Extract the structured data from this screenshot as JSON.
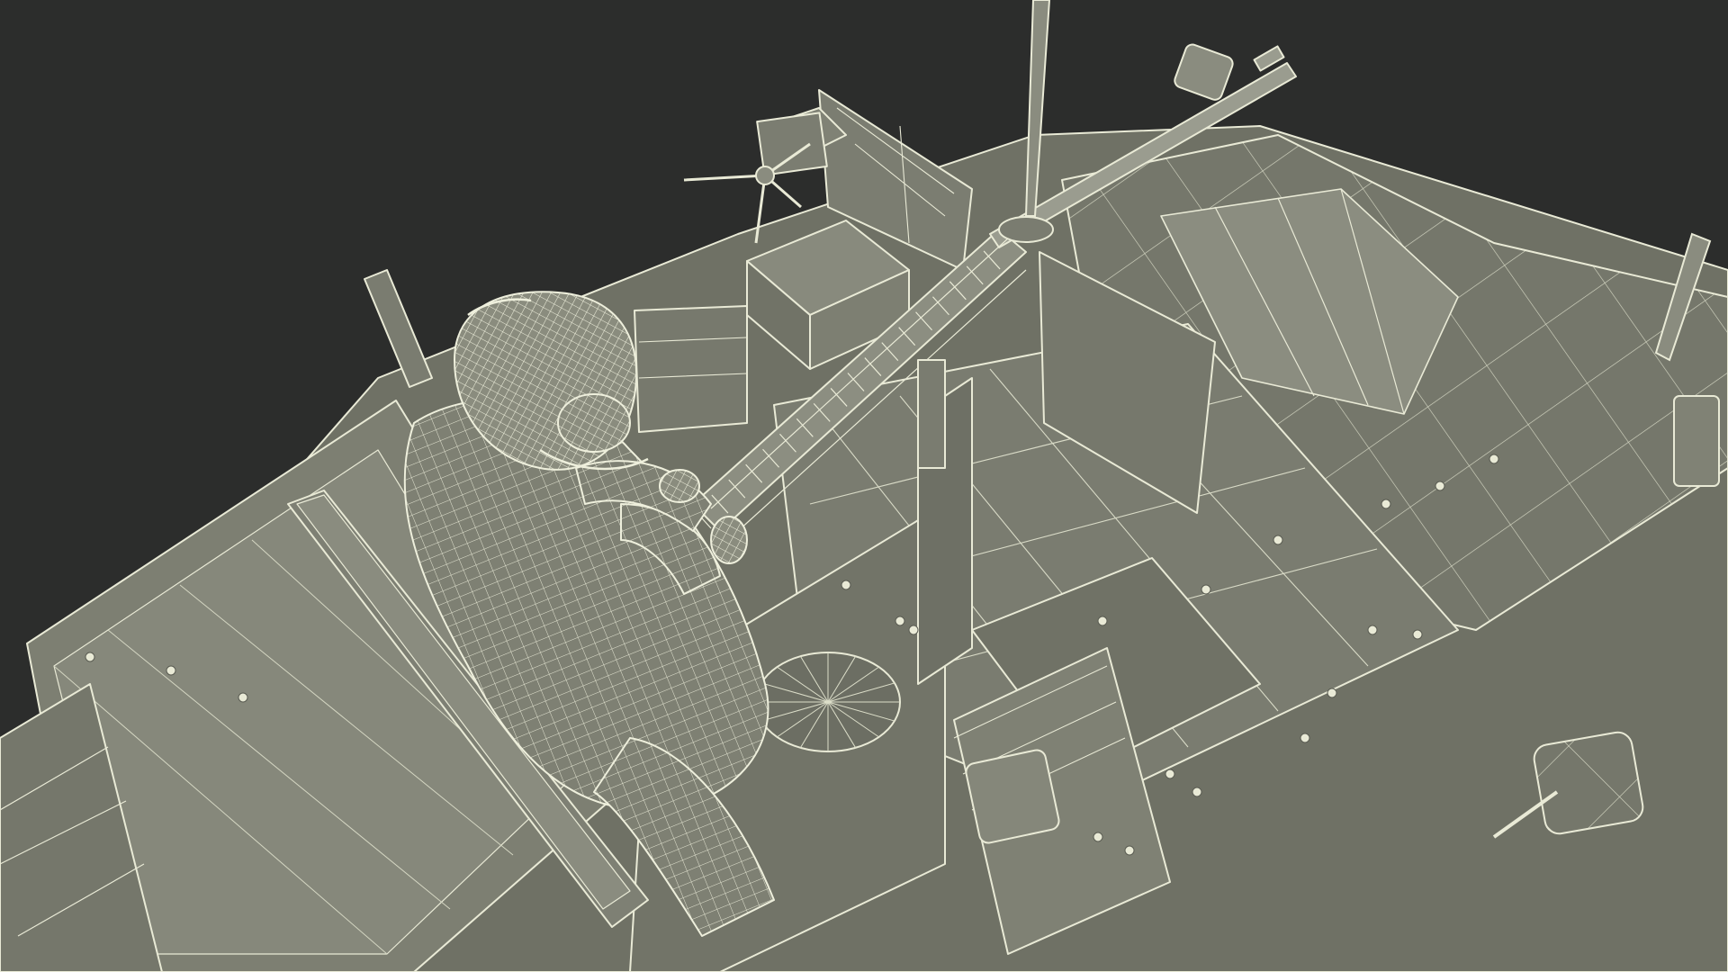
{
  "scene": {
    "background_color": "#2c2d2c",
    "model_fill_color": "#7b7d6f",
    "model_shadow_color": "#5f6156",
    "wire_color": "#e9ead6",
    "wire_dim_color": "#b9bba8"
  }
}
